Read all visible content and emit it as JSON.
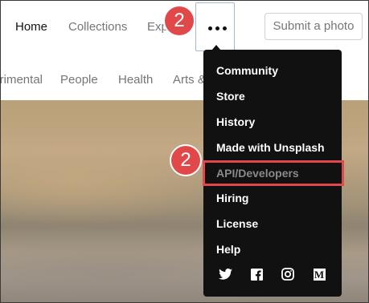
{
  "nav": {
    "home": "Home",
    "collections": "Collections",
    "explore": "Explore",
    "submit": "Submit a photo"
  },
  "categories": [
    "Experimental",
    "People",
    "Health",
    "Arts & Culture"
  ],
  "menu": {
    "items": [
      {
        "label": "Community"
      },
      {
        "label": "Store"
      },
      {
        "label": "History"
      },
      {
        "label": "Made with Unsplash"
      },
      {
        "label": "API/Developers"
      },
      {
        "label": "Hiring"
      },
      {
        "label": "License"
      },
      {
        "label": "Help"
      }
    ],
    "social": [
      "twitter-icon",
      "facebook-icon",
      "instagram-icon",
      "medium-icon"
    ],
    "medium_glyph": "M"
  },
  "annotations": {
    "step_top": "2",
    "step_menu": "2",
    "accent": "#e0484a"
  }
}
